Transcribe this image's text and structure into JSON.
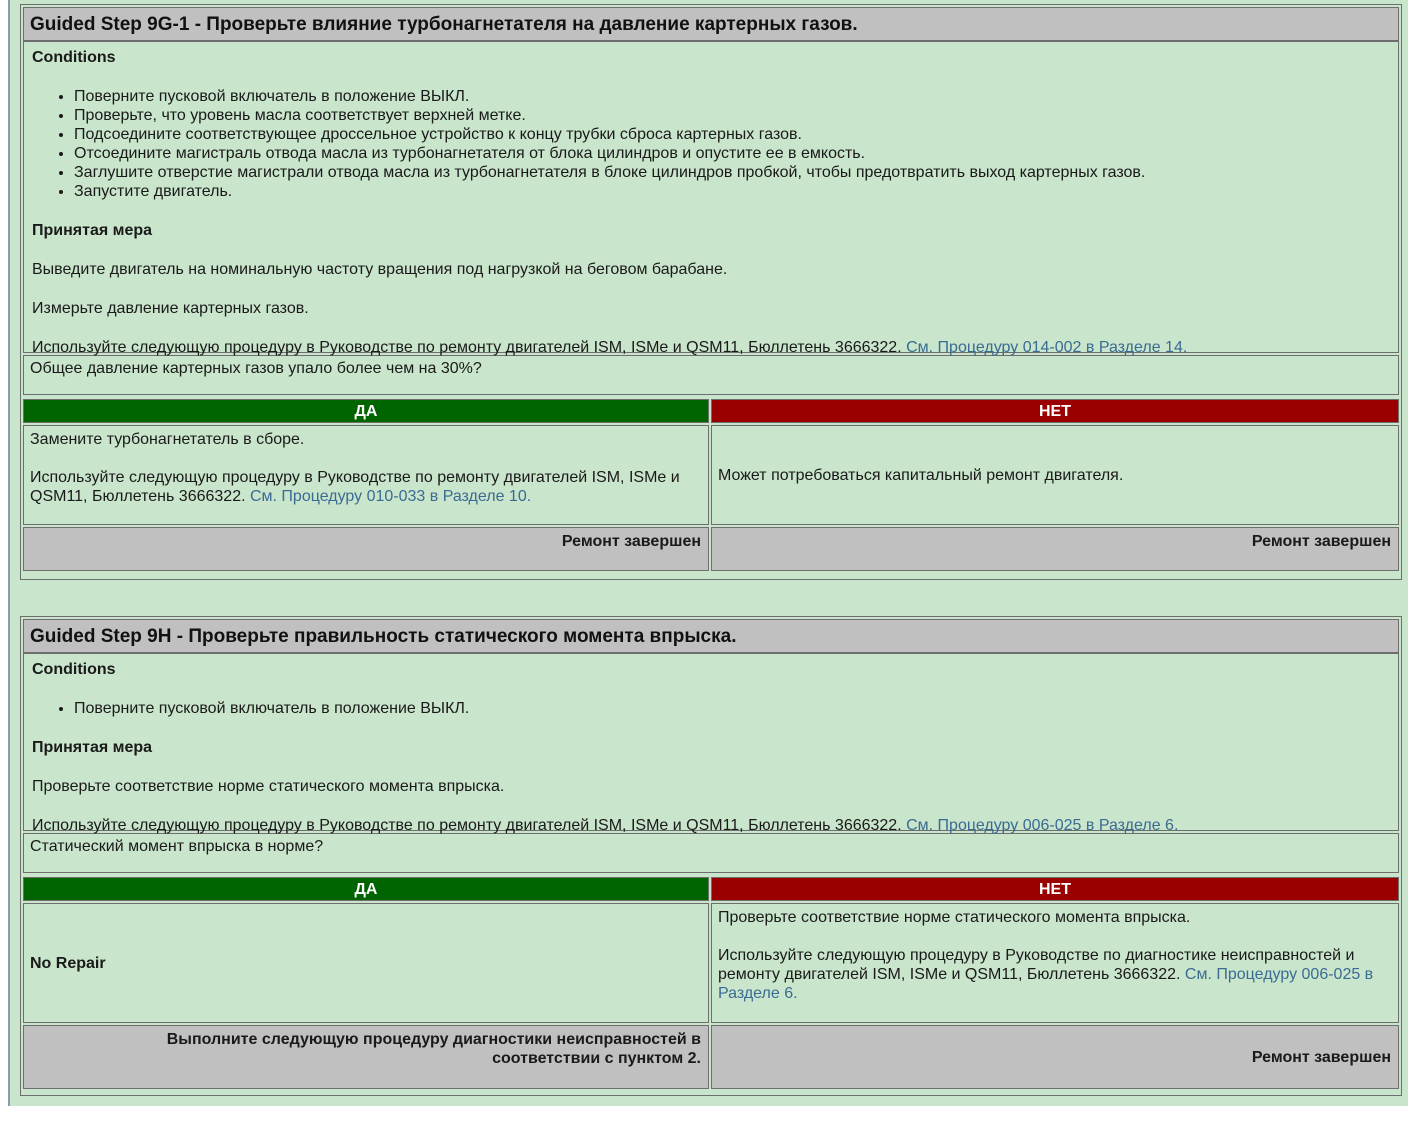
{
  "steps": [
    {
      "title": "Guided Step 9G-1 - Проверьте влияние турбонагнетателя на давление картерных газов.",
      "conditions_label": "Conditions",
      "conditions": [
        "Поверните пусковой включатель в положение ВЫКЛ.",
        "Проверьте, что уровень масла соответствует верхней метке.",
        "Подсоедините соответствующее дроссельное устройство к концу трубки сброса картерных газов.",
        "Отсоедините магистраль отвода масла из турбонагнетателя от блока цилиндров и опустите ее в емкость.",
        "Заглушите отверстие магистрали отвода масла из турбонагнетателя в блоке цилиндров пробкой, чтобы предотвратить выход картерных газов.",
        "Запустите двигатель."
      ],
      "action_label": "Принятая мера",
      "action_1": "Выведите двигатель на номинальную частоту вращения под нагрузкой на беговом барабане.",
      "action_2": "Измерьте давление картерных газов.",
      "ref_text": "Используйте следующую процедуру в Руководстве по ремонту двигателей ISM, ISMe и QSM11, Бюллетень 3666322.",
      "ref_link": "См. Процедуру 014-002 в Разделе 14.",
      "question": "Общее давление картерных газов упало более чем на 30%?",
      "yes_label": "ДА",
      "no_label": "НЕТ",
      "yes_text_1": "Замените турбонагнетатель в сборе.",
      "yes_text_2": "Используйте следующую процедуру в Руководстве по ремонту двигателей ISM, ISMe и QSM11, Бюллетень 3666322.",
      "yes_link": "См. Процедуру 010-033 в Разделе 10.",
      "no_text": "Может потребоваться капитальный ремонт двигателя.",
      "yes_footer": "Ремонт завершен",
      "no_footer": "Ремонт завершен"
    },
    {
      "title": "Guided Step 9H - Проверьте правильность статического момента впрыска.",
      "conditions_label": "Conditions",
      "conditions": [
        "Поверните пусковой включатель в положение ВЫКЛ."
      ],
      "action_label": "Принятая мера",
      "action_1": "Проверьте соответствие норме статического момента впрыска.",
      "ref_text": "Используйте следующую процедуру в Руководстве по ремонту двигателей ISM, ISMe и QSM11, Бюллетень 3666322.",
      "ref_link": "См. Процедуру 006-025 в Разделе 6.",
      "question": "Статический момент впрыска в норме?",
      "yes_label": "ДА",
      "no_label": "НЕТ",
      "yes_text": "No Repair",
      "no_text_1": "Проверьте соответствие норме статического момента впрыска.",
      "no_text_2": "Используйте следующую процедуру в Руководстве по диагностике неисправностей и ремонту двигателей ISM, ISMe и QSM11, Бюллетень 3666322.",
      "no_link": "См. Процедуру 006-025 в Разделе 6.",
      "yes_footer": "Выполните следующую процедуру диагностики неисправностей в соответствии с пунктом 2.",
      "no_footer": "Ремонт завершен"
    }
  ],
  "colors": {
    "yes": "#006400",
    "no": "#9b0000",
    "panel": "#c9e5cb",
    "header": "#c0c0c0",
    "link": "#3a6b93"
  }
}
